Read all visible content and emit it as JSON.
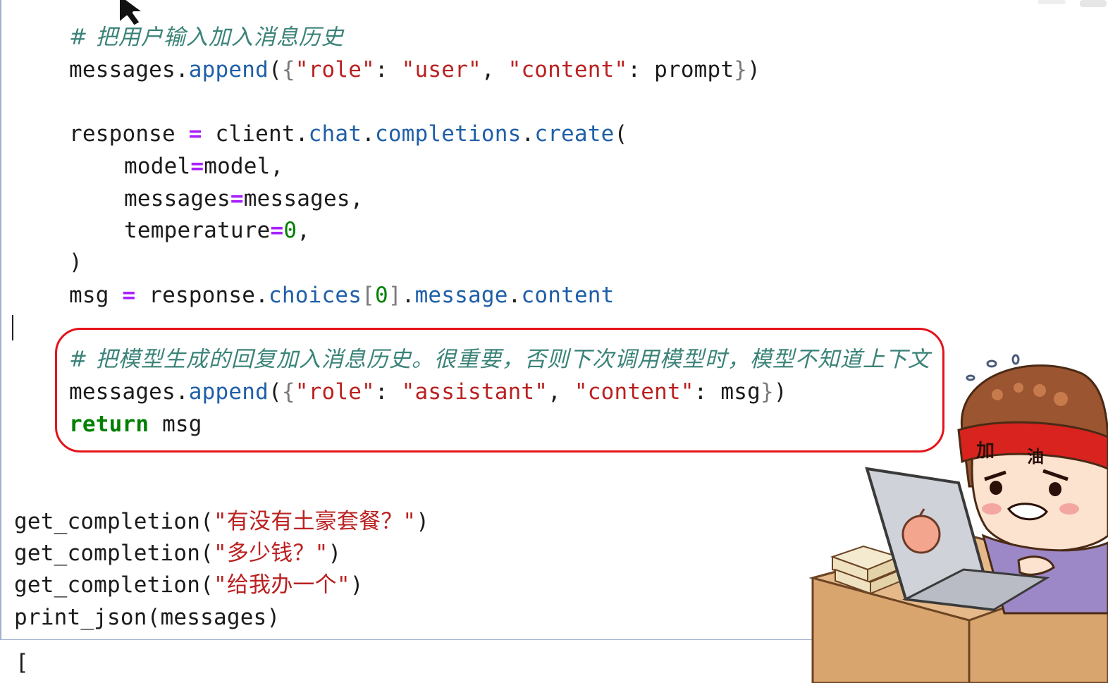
{
  "code": {
    "comment_add_user": "# 把用户输入加入消息历史",
    "line_append_user": {
      "obj": "messages",
      "method": "append",
      "key_role": "\"role\"",
      "val_role": "\"user\"",
      "key_content": "\"content\"",
      "val_content": "prompt"
    },
    "line_response": {
      "var": "response",
      "client": "client",
      "attr1": "chat",
      "attr2": "completions",
      "attr3": "create"
    },
    "arg_model": {
      "name": "model",
      "value": "model"
    },
    "arg_messages": {
      "name": "messages",
      "value": "messages"
    },
    "arg_temperature": {
      "name": "temperature",
      "value": "0"
    },
    "close_paren": ")",
    "line_msg": {
      "var": "msg",
      "obj": "response",
      "attr1": "choices",
      "index": "0",
      "attr2": "message",
      "attr3": "content"
    },
    "comment_add_assistant": "# 把模型生成的回复加入消息历史。很重要，否则下次调用模型时，模型不知道上下文",
    "line_append_assistant": {
      "obj": "messages",
      "method": "append",
      "key_role": "\"role\"",
      "val_role": "\"assistant\"",
      "key_content": "\"content\"",
      "val_content": "msg"
    },
    "line_return": {
      "keyword": "return",
      "value": "msg"
    },
    "calls": [
      {
        "fn": "get_completion",
        "arg": "\"有没有土豪套餐？\""
      },
      {
        "fn": "get_completion",
        "arg": "\"多少钱？\""
      },
      {
        "fn": "get_completion",
        "arg": "\"给我办一个\""
      }
    ],
    "print_call": {
      "fn": "print_json",
      "arg": "messages"
    }
  },
  "output": {
    "first_char": "["
  },
  "overlay": {
    "headband_text_1": "加",
    "headband_text_2": "油"
  },
  "colors": {
    "comment": "#3a8378",
    "string": "#ba2121",
    "keyword": "#008000",
    "operator": "#aa22ff",
    "attribute": "#1f5fa8",
    "highlight_box": "#e5131a",
    "cell_border": "#9fb1cf"
  },
  "icons": [
    "mouse-pointer-icon",
    "text-cursor"
  ]
}
